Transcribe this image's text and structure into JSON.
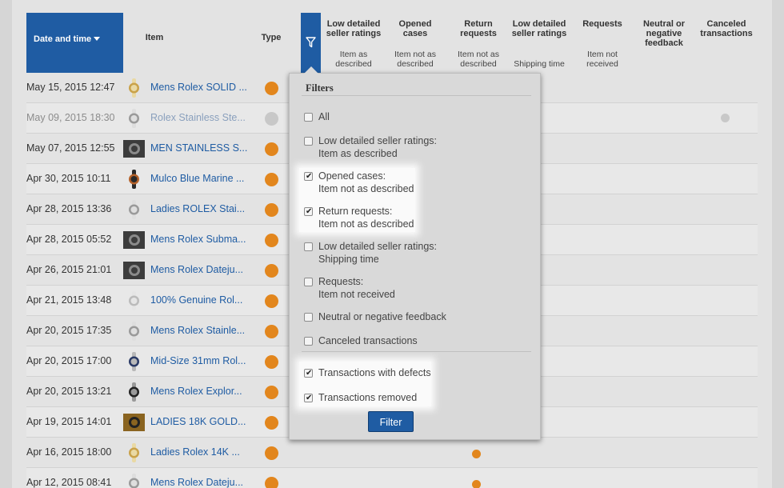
{
  "header": {
    "date_col": "Date and time",
    "item_col": "Item",
    "type_col": "Type",
    "columns": [
      {
        "title": "Low detailed seller ratings",
        "sub": "Item as described"
      },
      {
        "title": "Opened cases",
        "sub": "Item not as described"
      },
      {
        "title": "Return requests",
        "sub": "Item not as described"
      },
      {
        "title": "Low detailed seller ratings",
        "sub": "Shipping time"
      },
      {
        "title": "Requests",
        "sub": "Item not received"
      },
      {
        "title": "Neutral or negative feedback",
        "sub": ""
      },
      {
        "title": "Canceled transactions",
        "sub": ""
      }
    ]
  },
  "rows": [
    {
      "date": "May 15, 2015 12:47",
      "title": "Mens Rolex SOLID ...",
      "thumb": "watch-gold"
    },
    {
      "date": "May 09, 2015 18:30",
      "title": "Rolex Stainless Ste...",
      "thumb": "watch-silver",
      "muted": true
    },
    {
      "date": "May 07, 2015 12:55",
      "title": "MEN STAINLESS S...",
      "thumb": "watch-dark"
    },
    {
      "date": "Apr 30, 2015 10:11",
      "title": "Mulco Blue Marine ...",
      "thumb": "watch-orange"
    },
    {
      "date": "Apr 28, 2015 13:36",
      "title": "Ladies ROLEX Stai...",
      "thumb": "watch-silver"
    },
    {
      "date": "Apr 28, 2015 05:52",
      "title": "Mens Rolex Subma...",
      "thumb": "watch-dark"
    },
    {
      "date": "Apr 26, 2015 21:01",
      "title": "Mens Rolex Dateju...",
      "thumb": "watch-dark"
    },
    {
      "date": "Apr 21, 2015 13:48",
      "title": "100% Genuine Rol...",
      "thumb": "watch-flat"
    },
    {
      "date": "Apr 20, 2015 17:35",
      "title": "Mens Rolex Stainle...",
      "thumb": "watch-silver"
    },
    {
      "date": "Apr 20, 2015 17:00",
      "title": "Mid-Size 31mm Rol...",
      "thumb": "watch-blue"
    },
    {
      "date": "Apr 20, 2015 13:21",
      "title": "Mens Rolex Explor...",
      "thumb": "watch-black"
    },
    {
      "date": "Apr 19, 2015 14:01",
      "title": "LADIES 18K GOLD...",
      "thumb": "watch-gold-dark"
    },
    {
      "date": "Apr 16, 2015 18:00",
      "title": "Ladies Rolex 14K ...",
      "thumb": "watch-gold"
    },
    {
      "date": "Apr 12, 2015 08:41",
      "title": "Mens Rolex Dateju...",
      "thumb": "watch-silver"
    }
  ],
  "filters": {
    "title": "Filters",
    "options": [
      {
        "line1": "All",
        "line2": "",
        "checked": false
      },
      {
        "line1": "Low detailed seller ratings:",
        "line2": "Item as described",
        "checked": false
      },
      {
        "line1": "Opened cases:",
        "line2": "Item not as described",
        "checked": true
      },
      {
        "line1": "Return requests:",
        "line2": "Item not as described",
        "checked": true
      },
      {
        "line1": "Low detailed seller ratings:",
        "line2": "Shipping time",
        "checked": false
      },
      {
        "line1": "Requests:",
        "line2": "Item not received",
        "checked": false
      },
      {
        "line1": "Neutral or negative feedback",
        "line2": "",
        "checked": false
      },
      {
        "line1": "Canceled transactions",
        "line2": "",
        "checked": false
      },
      {
        "line1": "Transactions with defects",
        "line2": "",
        "checked": true
      },
      {
        "line1": "Transactions removed",
        "line2": "",
        "checked": true
      }
    ],
    "button_label": "Filter"
  },
  "colors": {
    "accent": "#1f5ca3",
    "status_orange": "#e2861d",
    "status_grey": "#c8c8c8"
  }
}
